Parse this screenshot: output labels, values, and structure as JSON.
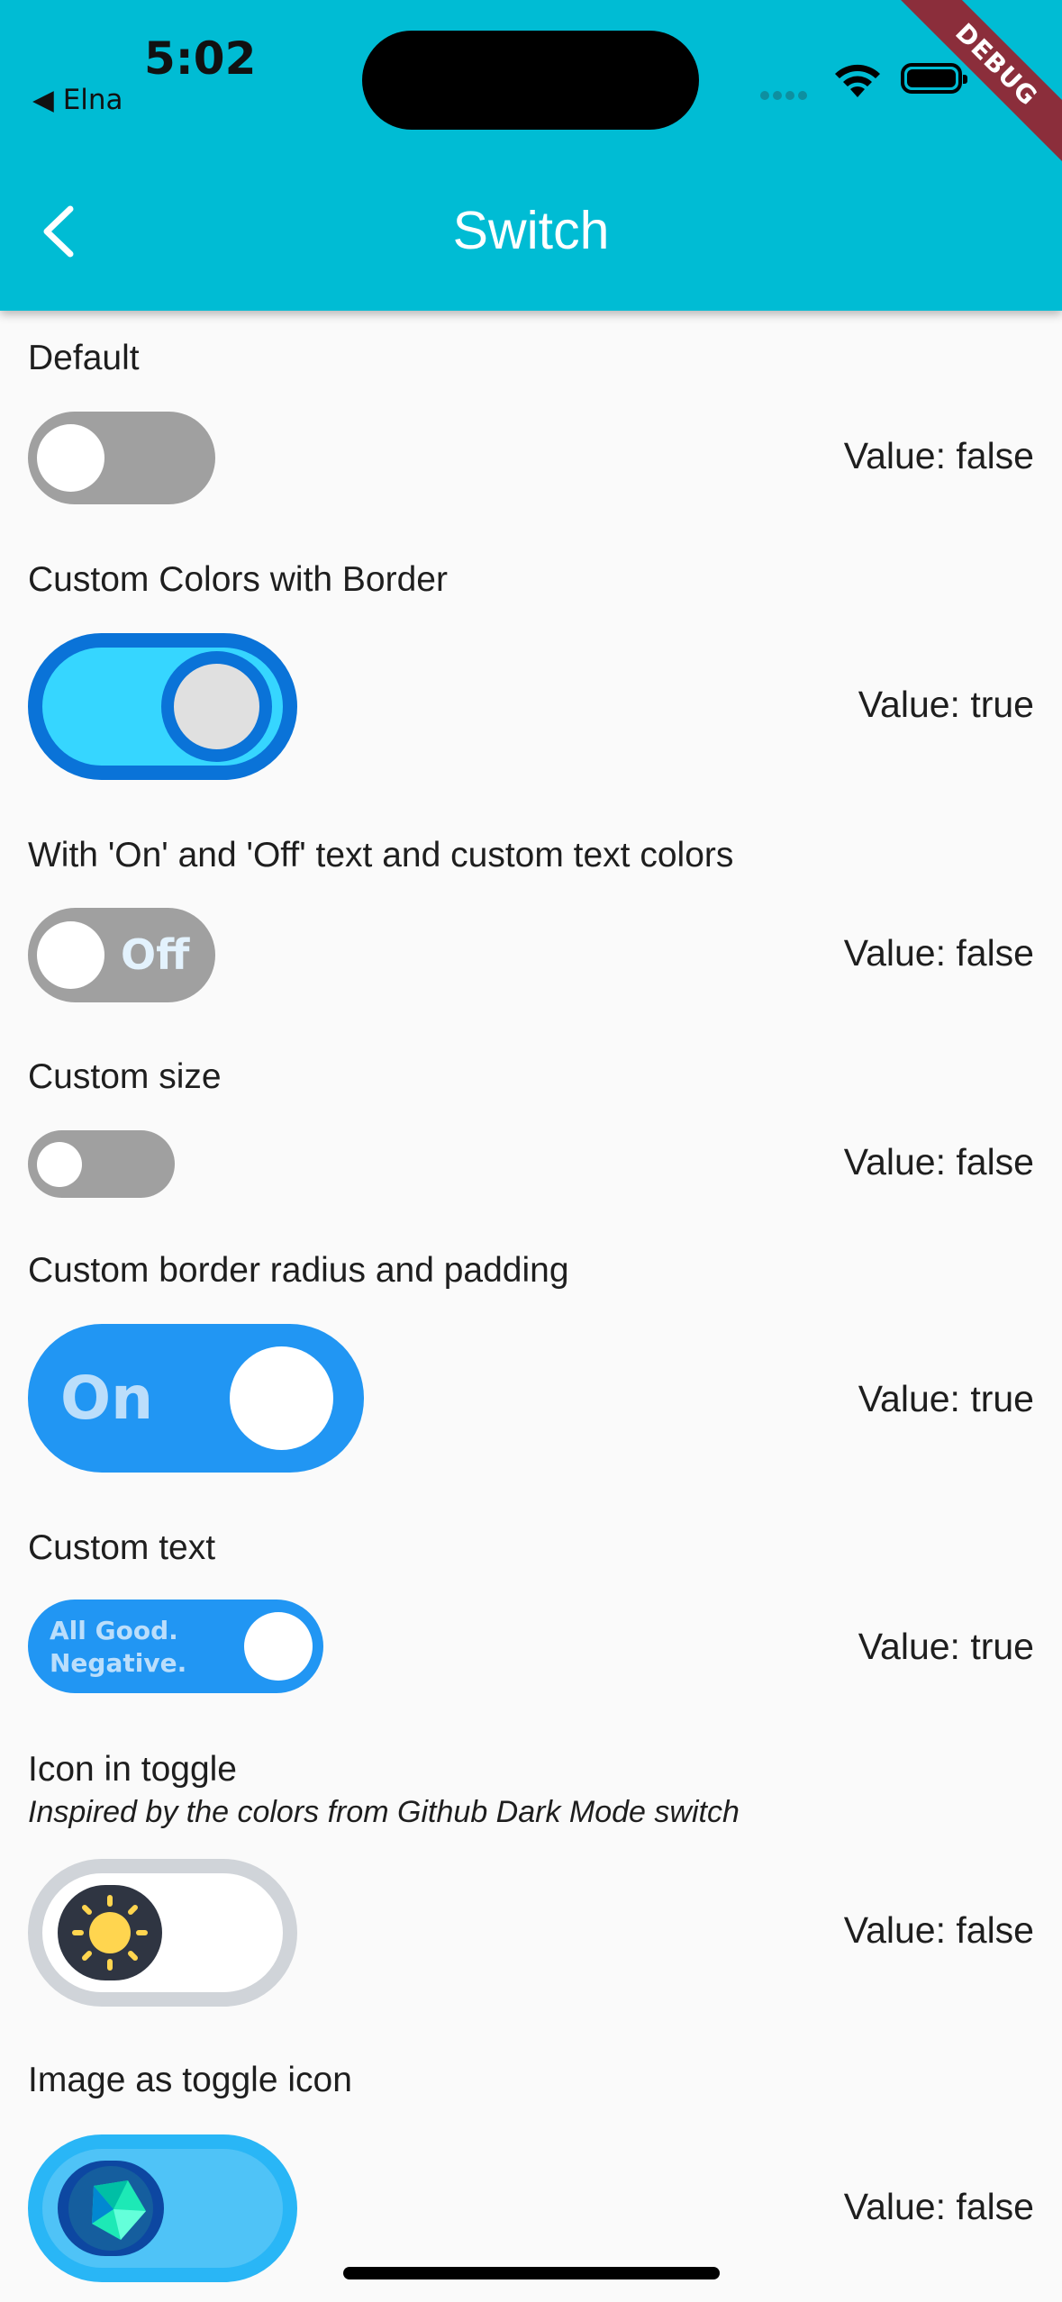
{
  "status_bar": {
    "time": "5:02",
    "back_app": "◀ Elna",
    "debug": "DEBUG"
  },
  "app_bar": {
    "title": "Switch",
    "color": "#00bcd4"
  },
  "items": [
    {
      "label": "Default",
      "value": "Value: false",
      "state": false
    },
    {
      "label": "Custom Colors with Border",
      "value": "Value: true",
      "state": true
    },
    {
      "label": "With 'On' and 'Off' text and custom text colors",
      "value": "Value: false",
      "state": false,
      "switch_text": "Off"
    },
    {
      "label": "Custom size",
      "value": "Value: false",
      "state": false
    },
    {
      "label": "Custom border radius and padding",
      "value": "Value: true",
      "state": true,
      "switch_text": "On"
    },
    {
      "label": "Custom text",
      "value": "Value: true",
      "state": true,
      "switch_text_line1": "All Good.",
      "switch_text_line2": "Negative."
    },
    {
      "label": "Icon in toggle",
      "sublabel": "Inspired by the colors from Github Dark Mode switch",
      "value": "Value: false",
      "state": false,
      "icon": "sun-icon"
    },
    {
      "label": "Image as toggle icon",
      "value": "Value: false",
      "state": false,
      "icon": "dart-logo-icon"
    }
  ],
  "colors": {
    "switch_off": "#a0a0a0",
    "custom_border": "#0a73d8",
    "custom_fill": "#36d6ff",
    "blue": "#2196f3",
    "light_text": "#bbdefb",
    "github_dark": "#2f3542",
    "sun": "#ffd54f",
    "image_toggle": "#4fc3f7"
  }
}
